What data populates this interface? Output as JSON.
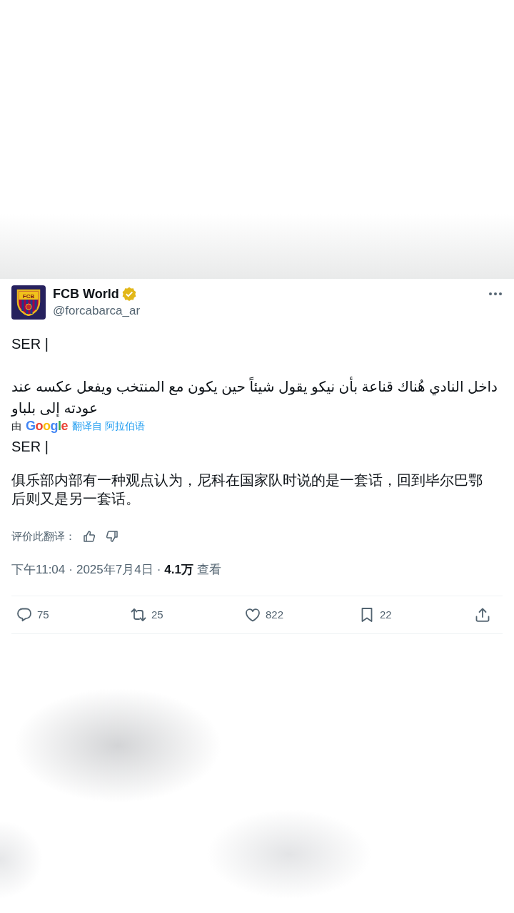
{
  "author": {
    "avatar_label": "FCB",
    "name": "FCB World",
    "verified": true,
    "handle": "@forcabarca_ar"
  },
  "original_text": [
    "SER |",
    "داخل النادي هُناك قناعة بأن نيكو يقول شيئاً حين يكون مع المنتخب ويفعل عكسه عند عودته إلى بلباو"
  ],
  "translation_credit": {
    "prefix": "由",
    "logo": "Google",
    "link": "翻译自 阿拉伯语"
  },
  "translated_text": [
    "SER |",
    "俱乐部内部有一种观点认为，尼科在国家队时说的是一套话，回到毕尔巴鄂后则又是另一套话。"
  ],
  "rate_translation": {
    "label": "评价此翻译："
  },
  "meta": [
    {
      "kind": "time",
      "text": "下午11:04"
    },
    {
      "kind": "separator",
      "text": "·"
    },
    {
      "kind": "date",
      "text": "2025年7月4日"
    },
    {
      "kind": "separator",
      "text": "·"
    },
    {
      "kind": "views_count",
      "text": "4.1万"
    },
    {
      "kind": "views_label",
      "text": "查看"
    }
  ],
  "actions": [
    {
      "kind": "reply",
      "count": "75"
    },
    {
      "kind": "repost",
      "count": "25"
    },
    {
      "kind": "like",
      "count": "822"
    },
    {
      "kind": "bookmark",
      "count": "22"
    },
    {
      "kind": "share"
    }
  ]
}
